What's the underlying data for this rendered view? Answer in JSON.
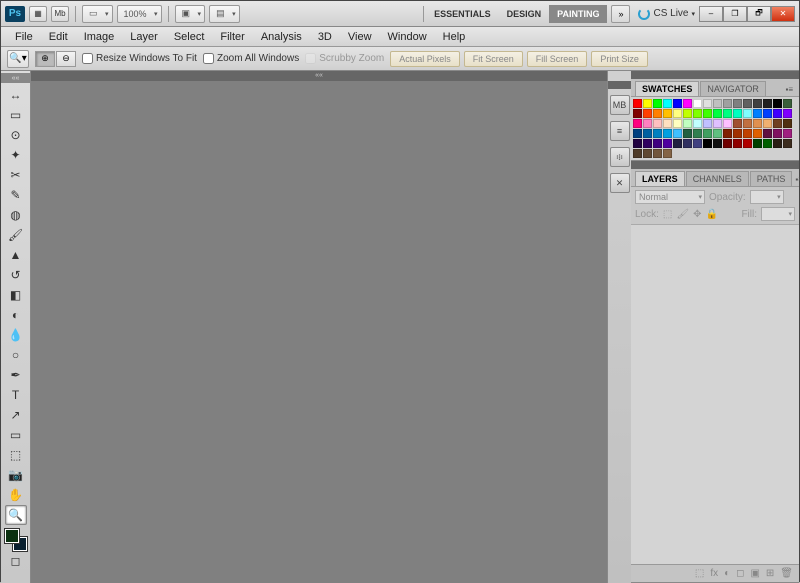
{
  "titlebar": {
    "logo": "Ps",
    "zoom_value": "100%",
    "workspaces": [
      "ESSENTIALS",
      "DESIGN",
      "PAINTING"
    ],
    "active_workspace": 2,
    "expand": "»",
    "cslive": "CS Live",
    "win": {
      "min": "–",
      "max": "❐",
      "restore": "🗗",
      "close": "✕"
    }
  },
  "menu": [
    "File",
    "Edit",
    "Image",
    "Layer",
    "Select",
    "Filter",
    "Analysis",
    "3D",
    "View",
    "Window",
    "Help"
  ],
  "options": {
    "resize_label": "Resize Windows To Fit",
    "zoom_all_label": "Zoom All Windows",
    "scrubby_label": "Scrubby Zoom",
    "buttons": [
      "Actual Pixels",
      "Fit Screen",
      "Fill Screen",
      "Print Size"
    ]
  },
  "tools": [
    {
      "name": "move-tool",
      "glyph": "↔"
    },
    {
      "name": "marquee-tool",
      "glyph": "▭"
    },
    {
      "name": "lasso-tool",
      "glyph": "⊙"
    },
    {
      "name": "wand-tool",
      "glyph": "✦"
    },
    {
      "name": "crop-tool",
      "glyph": "✂"
    },
    {
      "name": "eyedropper-tool",
      "glyph": "✎"
    },
    {
      "name": "heal-tool",
      "glyph": "◍"
    },
    {
      "name": "brush-tool",
      "glyph": "🖌"
    },
    {
      "name": "stamp-tool",
      "glyph": "▲"
    },
    {
      "name": "history-brush-tool",
      "glyph": "↺"
    },
    {
      "name": "eraser-tool",
      "glyph": "◧"
    },
    {
      "name": "gradient-tool",
      "glyph": "◐"
    },
    {
      "name": "blur-tool",
      "glyph": "💧"
    },
    {
      "name": "dodge-tool",
      "glyph": "○"
    },
    {
      "name": "pen-tool",
      "glyph": "✒"
    },
    {
      "name": "type-tool",
      "glyph": "T"
    },
    {
      "name": "path-tool",
      "glyph": "↗"
    },
    {
      "name": "shape-tool",
      "glyph": "▭"
    },
    {
      "name": "3d-tool",
      "glyph": "⬚"
    },
    {
      "name": "camera-tool",
      "glyph": "📷"
    },
    {
      "name": "hand-tool",
      "glyph": "✋"
    },
    {
      "name": "zoom-tool",
      "glyph": "🔍",
      "active": true
    }
  ],
  "swatch_colors": [
    "#ff0000",
    "#ffff00",
    "#00ff00",
    "#00ffff",
    "#0000ff",
    "#ff00ff",
    "#ffffff",
    "#e0e0e0",
    "#c0c0c0",
    "#a0a0a0",
    "#808080",
    "#606060",
    "#404040",
    "#202020",
    "#000000",
    "#3a5f3a",
    "#800000",
    "#ff4000",
    "#ff8000",
    "#ffc000",
    "#ffff80",
    "#c0ff00",
    "#80ff00",
    "#40ff00",
    "#00ff40",
    "#00ff80",
    "#00ffc0",
    "#80ffff",
    "#0080ff",
    "#0040ff",
    "#4000ff",
    "#8000ff",
    "#ff0080",
    "#ff80c0",
    "#ffc0c0",
    "#ffe0c0",
    "#ffffc0",
    "#c0ffc0",
    "#c0ffff",
    "#c0c0ff",
    "#e0c0ff",
    "#ffc0ff",
    "#a05030",
    "#c07040",
    "#e09050",
    "#f0b070",
    "#704020",
    "#503010",
    "#004080",
    "#0060a0",
    "#0080c0",
    "#00a0e0",
    "#40c0ff",
    "#206040",
    "#308050",
    "#40a060",
    "#60c080",
    "#802000",
    "#a03000",
    "#c04000",
    "#e06000",
    "#601040",
    "#801060",
    "#a02080",
    "#200040",
    "#300060",
    "#400080",
    "#5000a0",
    "#202040",
    "#303060",
    "#404080",
    "#000000",
    "#101010",
    "#700000",
    "#900000",
    "#b00000",
    "#004000",
    "#006000",
    "#2a1e14",
    "#3c2c1e",
    "#4e3a28",
    "#604832",
    "#72563c",
    "#846446"
  ],
  "dock_icons": [
    {
      "name": "mini-bridge-icon",
      "glyph": "MB"
    },
    {
      "name": "brushes-icon",
      "glyph": "≡"
    },
    {
      "name": "brush-presets-icon",
      "glyph": "፨"
    },
    {
      "name": "tool-presets-icon",
      "glyph": "✕"
    }
  ],
  "swatches_tabs": [
    "SWATCHES",
    "NAVIGATOR"
  ],
  "layers_tabs": [
    "LAYERS",
    "CHANNELS",
    "PATHS"
  ],
  "layers": {
    "blend": "Normal",
    "opacity_label": "Opacity:",
    "lock_label": "Lock:",
    "fill_label": "Fill:"
  },
  "foot_icons": [
    "⬚",
    "fx",
    "◐",
    "◻",
    "▣",
    "⊞",
    "🗑"
  ]
}
